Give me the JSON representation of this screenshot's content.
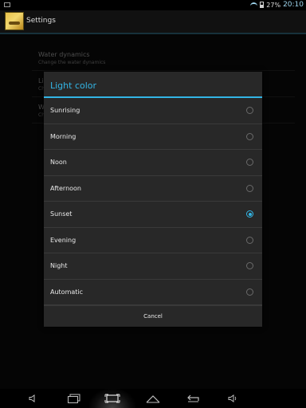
{
  "status_bar": {
    "battery_percent": "27%",
    "time": "20:10",
    "icons": [
      "notification-icon",
      "wifi-icon",
      "battery-icon"
    ]
  },
  "action_bar": {
    "title": "Settings",
    "app_icon": "app-icon"
  },
  "background_list": {
    "items": [
      {
        "title": "Water dynamics",
        "summary": "Change the water dynamics"
      },
      {
        "title": "Li",
        "summary": "Ch"
      },
      {
        "title": "W",
        "summary": "Ch"
      }
    ]
  },
  "dialog": {
    "title": "Light color",
    "options": [
      {
        "label": "Sunrising",
        "selected": false
      },
      {
        "label": "Morning",
        "selected": false
      },
      {
        "label": "Noon",
        "selected": false
      },
      {
        "label": "Afternoon",
        "selected": false
      },
      {
        "label": "Sunset",
        "selected": true
      },
      {
        "label": "Evening",
        "selected": false
      },
      {
        "label": "Night",
        "selected": false
      },
      {
        "label": "Automatic",
        "selected": false
      }
    ],
    "cancel_label": "Cancel"
  },
  "nav_bar": {
    "buttons": [
      "volume-down-icon",
      "recent-apps-icon",
      "screenshot-icon",
      "home-icon",
      "back-icon",
      "volume-up-icon"
    ]
  },
  "colors": {
    "accent": "#33b5e5",
    "dialog_background": "#282828",
    "screen_background": "#0a0a0a"
  }
}
